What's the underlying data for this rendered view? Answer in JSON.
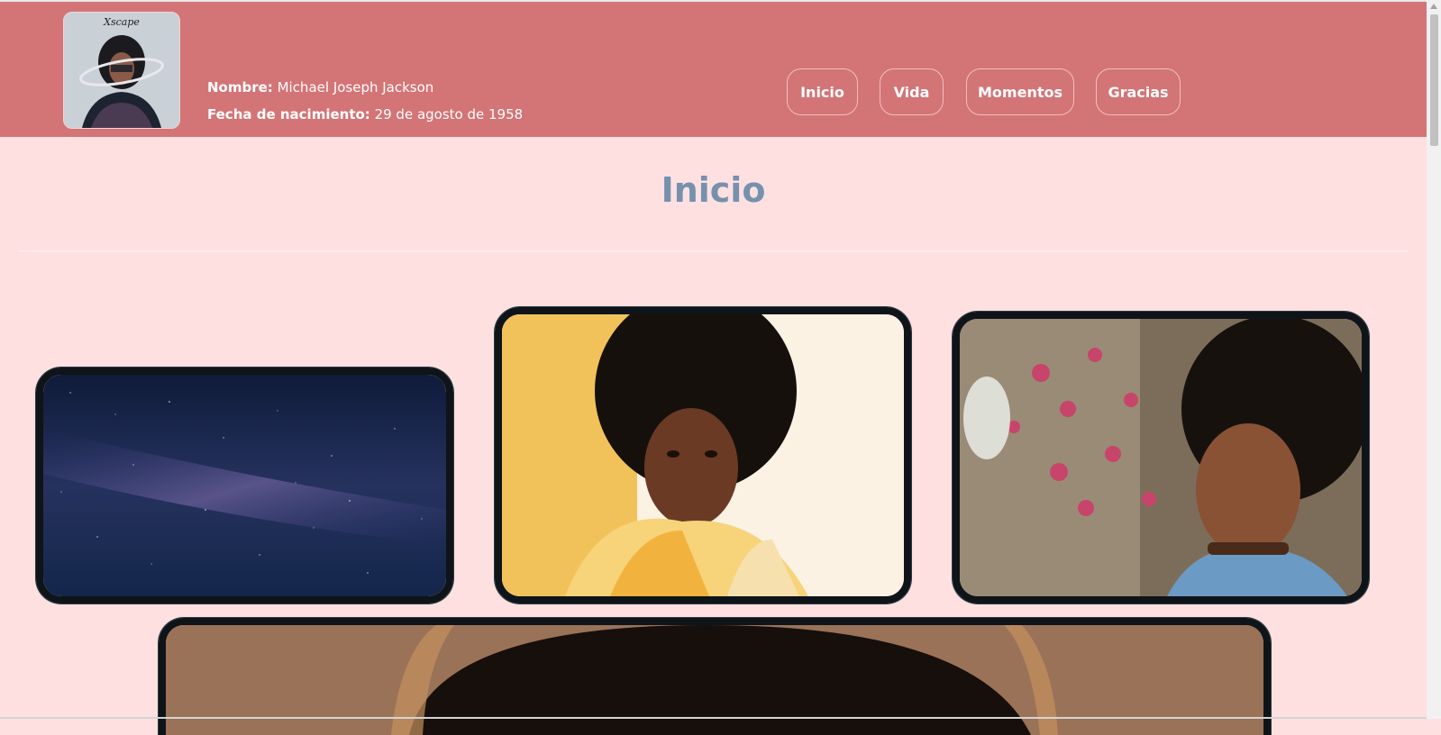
{
  "profile": {
    "name_label": "Nombre:",
    "name_value": "Michael Joseph Jackson",
    "birth_label": "Fecha de nacimiento:",
    "birth_value": "29 de agosto de 1958",
    "album_text": "Xscape"
  },
  "nav": {
    "items": [
      {
        "label": "Inicio"
      },
      {
        "label": "Vida"
      },
      {
        "label": "Momentos"
      },
      {
        "label": "Gracias"
      }
    ]
  },
  "main": {
    "title": "Inicio"
  },
  "colors": {
    "header_bg": "#d37476",
    "page_bg": "#ffe0e1",
    "title": "#7591ae",
    "frame_border": "#0f1419"
  }
}
